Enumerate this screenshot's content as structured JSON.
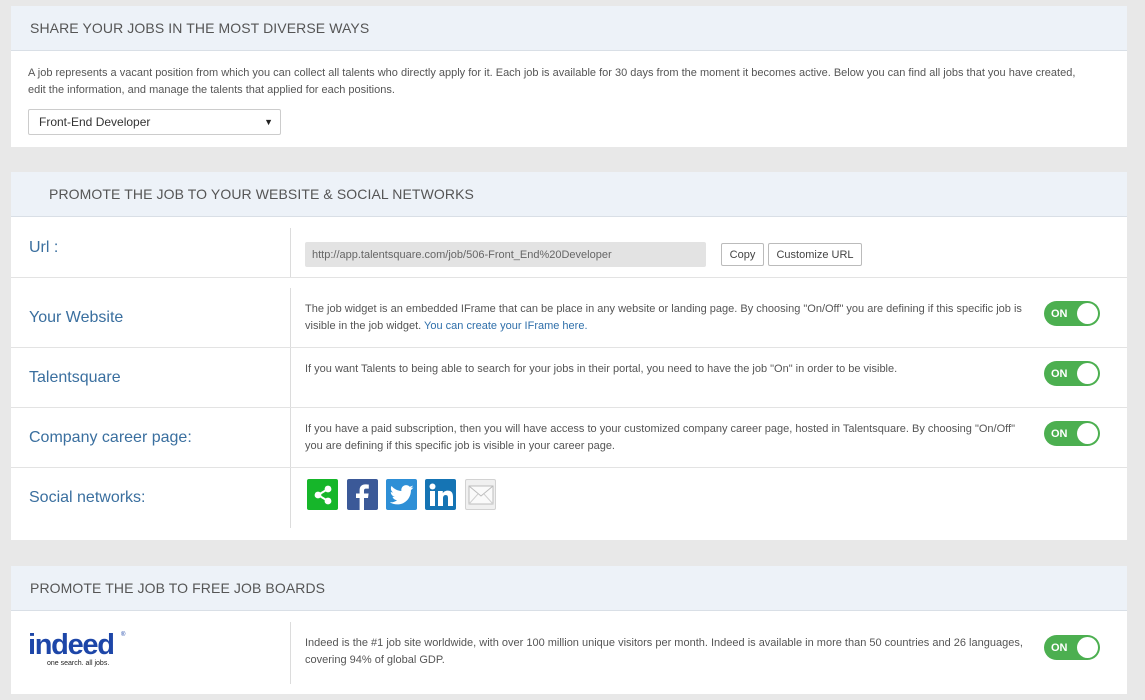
{
  "share_section": {
    "title": "SHARE YOUR JOBS IN THE MOST DIVERSE WAYS",
    "description": "A job represents a vacant position from which you can collect all talents who directly apply for it. Each job is available for 30 days from the moment it becomes active. Below you can find all jobs that you have created, edit the information, and manage the talents that applied for each positions.",
    "job_select": {
      "value": "Front-End Developer",
      "caret": "▼"
    }
  },
  "promote_section": {
    "title": "PROMOTE THE JOB TO YOUR WEBSITE & SOCIAL NETWORKS",
    "url_row": {
      "label": "Url :",
      "url_value": "http://app.talentsquare.com/job/506-Front_End%20Developer",
      "copy_label": "Copy",
      "customize_label": "Customize URL"
    },
    "website_row": {
      "label": "Your Website",
      "text": "The job widget is an embedded IFrame that can be place in any website or landing page. By choosing \"On/Off\" you are defining if this specific job is visible in the job widget. ",
      "link_text": "You can create your IFrame here.",
      "toggle": "ON"
    },
    "talentsquare_row": {
      "label": "Talentsquare",
      "text": "If you want Talents to being able to search for your jobs in their portal, you need to have the job \"On\" in order to be visible.",
      "toggle": "ON"
    },
    "career_row": {
      "label": "Company career page:",
      "text": "If you have a paid subscription, then you will have access to your customized company career page, hosted in Talentsquare. By choosing \"On/Off\" you are defining if this specific job is visible in your career page.",
      "toggle": "ON"
    },
    "social_row": {
      "label": "Social networks:",
      "icons": [
        "share-icon",
        "facebook-icon",
        "twitter-icon",
        "linkedin-icon",
        "email-icon"
      ],
      "colors": {
        "share": "#16b62a",
        "facebook": "#3b5998",
        "twitter": "#2e8fd6",
        "linkedin": "#1574b4"
      }
    }
  },
  "job_boards_section": {
    "title": "PROMOTE THE JOB TO FREE JOB BOARDS",
    "indeed": {
      "logo_text": "indeed",
      "logo_reg": "®",
      "logo_tagline": "one search. all jobs.",
      "text": "Indeed is the #1 job site worldwide, with over 100 million unique visitors per month. Indeed is available in more than 50 countries and 26 languages, covering 94% of global GDP.",
      "toggle": "ON"
    }
  },
  "colors": {
    "accent_label": "#3a6f9f",
    "toggle_on": "#4caf50",
    "header_bg": "#edf2f8"
  }
}
